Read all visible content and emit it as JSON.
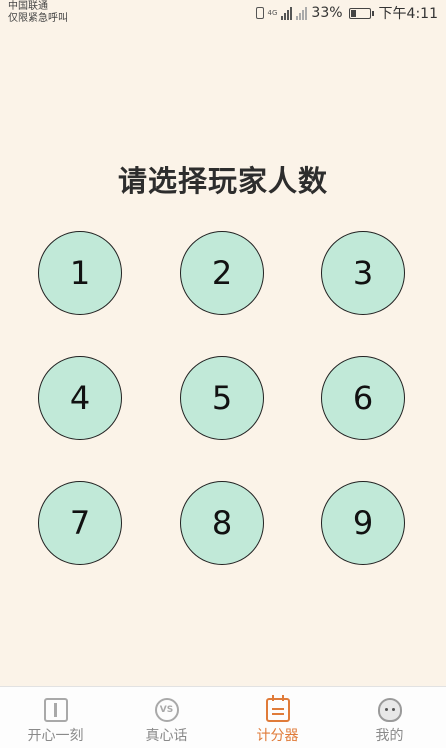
{
  "status_bar": {
    "carrier_line1": "中国联通",
    "carrier_line2": "仅限紧急呼叫",
    "network_tag": "4G",
    "battery_percent": "33%",
    "battery_level": 0.33,
    "time": "下午4:11"
  },
  "main": {
    "title": "请选择玩家人数",
    "buttons": [
      "1",
      "2",
      "3",
      "4",
      "5",
      "6",
      "7",
      "8",
      "9"
    ],
    "button_color": "#c1e9d8"
  },
  "tabbar": {
    "tabs": [
      {
        "label": "开心一刻",
        "icon": "book-icon"
      },
      {
        "label": "真心话",
        "icon": "vs-icon"
      },
      {
        "label": "计分器",
        "icon": "calendar-icon"
      },
      {
        "label": "我的",
        "icon": "avatar-icon"
      }
    ],
    "active_color": "#e07b39"
  }
}
